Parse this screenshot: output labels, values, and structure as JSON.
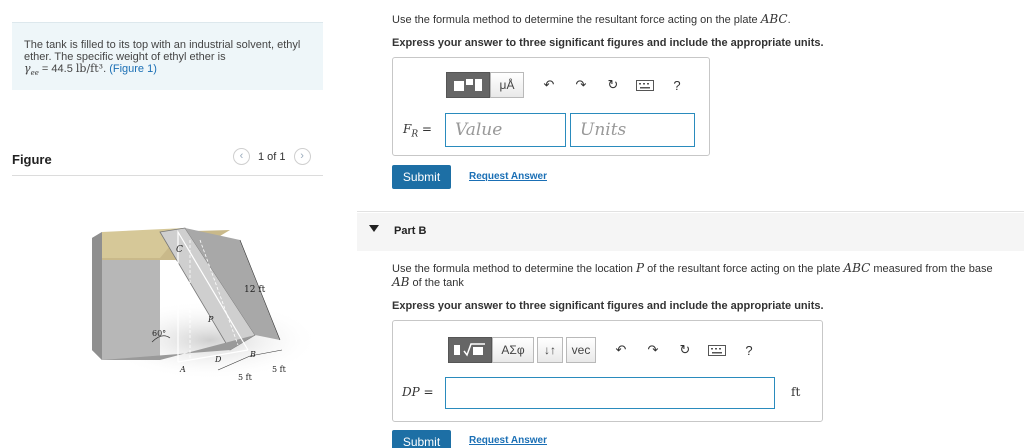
{
  "problem": {
    "text_1": "The tank is filled to its top with an industrial solvent, ethyl ether. The specific weight of ethyl ether is",
    "gamma_symbol": "γ",
    "gamma_subscript": "ee",
    "equals_value": " = 44.5 ",
    "unit": "lb/ft³",
    "after_unit": ". ",
    "figure_link": "(Figure 1)"
  },
  "figure": {
    "title": "Figure",
    "pager_text": "1 of 1",
    "prev_icon": "chevron-left-icon",
    "next_icon": "chevron-right-icon",
    "labels": {
      "c": "C",
      "p": "P",
      "b": "B",
      "d": "D",
      "a": "A",
      "angle": "60°",
      "height": "12 ft",
      "width_1": "5 ft",
      "width_2": "5 ft"
    }
  },
  "part_a": {
    "prompt_prefix": "Use the formula method to determine the resultant force acting on the plate ",
    "prompt_math": "ABC",
    "prompt_suffix": ".",
    "instruction": "Express your answer to three significant figures and include the appropriate units.",
    "toolbar": {
      "templates_icon": "templates-icon",
      "mu_a_label": "μÅ",
      "undo_icon": "undo-icon",
      "redo_icon": "redo-icon",
      "reset_icon": "reset-icon",
      "keyboard_icon": "keyboard-icon",
      "help_label": "?"
    },
    "field_label": "F",
    "field_label_sub": "R",
    "field_label_eq": " =",
    "value_placeholder": "Value",
    "units_placeholder": "Units",
    "submit_label": "Submit",
    "request_label": "Request Answer"
  },
  "part_b": {
    "title": "Part B",
    "prompt_prefix": "Use the formula method to determine the location ",
    "prompt_math_p": "P",
    "prompt_mid": " of the resultant force acting on the plate ",
    "prompt_math_abc": "ABC",
    "prompt_mid2": " measured from the base",
    "prompt_math_ab": "AB",
    "prompt_suffix": " of the tank",
    "instruction": "Express your answer to three significant figures and include the appropriate units.",
    "toolbar": {
      "templates_icon": "templates-sqrt-icon",
      "greek_label": "ΑΣφ",
      "arrows_label": "↓↑",
      "vec_label": "vec",
      "undo_icon": "undo-icon",
      "redo_icon": "redo-icon",
      "reset_icon": "reset-icon",
      "keyboard_icon": "keyboard-icon",
      "help_label": "?"
    },
    "field_label": "DP",
    "field_label_eq": " =",
    "unit": "ft",
    "submit_label": "Submit",
    "request_label": "Request Answer"
  }
}
